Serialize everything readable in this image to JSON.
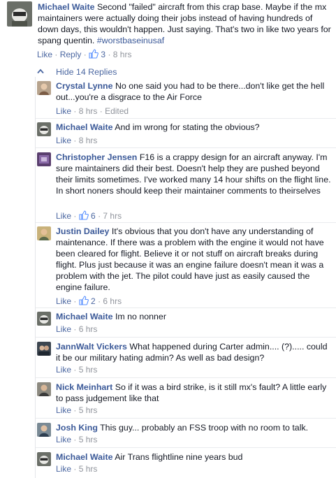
{
  "top_comment": {
    "author": "Michael Waite",
    "text": "Second \"failed\" aircraft from this crap base. Maybe if the mx maintainers were actually doing their jobs instead of having hundreds of down days, this wouldn't happen. Just saying. That's two in like two years for spang quentin.",
    "hashtag": "#worstbaseinusaf",
    "like_label": "Like",
    "reply_label": "Reply",
    "likes": "3",
    "time": "8 hrs"
  },
  "hide_replies_label": "Hide 14 Replies",
  "replies": [
    {
      "author": "Crystal Lynne",
      "text": "No one said you had to be there...don't like get the hell out...you're a disgrace to the Air Force",
      "like_label": "Like",
      "time": "8 hrs",
      "edited": "Edited",
      "likes": ""
    },
    {
      "author": "Michael Waite",
      "text": "And im wrong for stating the obvious?",
      "like_label": "Like",
      "time": "8 hrs",
      "edited": "",
      "likes": ""
    },
    {
      "author": "Christopher Jensen",
      "text": "F16 is a crappy design for an aircraft anyway. I'm sure maintainers did their best. Doesn't help they are pushed beyond their limits sometimes. I've worked many 14 hour shifts on the flight line. In short noners should keep their maintainer comments to theirselves",
      "like_label": "Like",
      "time": "7 hrs",
      "edited": "",
      "likes": "6"
    },
    {
      "author": "Justin Dailey",
      "text": "It's obvious that you don't have any understanding of maintenance. If there was a problem with the engine it would not have been cleared for flight. Believe it or not stuff on aircraft breaks during flight. Plus just because it was an engine failure doesn't mean it was a problem with the jet. The pilot could have just as easily caused the engine failure.",
      "like_label": "Like",
      "time": "6 hrs",
      "edited": "",
      "likes": "2"
    },
    {
      "author": "Michael Waite",
      "text": "Im no nonner",
      "like_label": "Like",
      "time": "6 hrs",
      "edited": "",
      "likes": ""
    },
    {
      "author": "JannWalt Vickers",
      "text": "What happened during Carter admin.... (?)..... could it be our military hating admin? As well as bad design?",
      "like_label": "Like",
      "time": "5 hrs",
      "edited": "",
      "likes": ""
    },
    {
      "author": "Nick Meinhart",
      "text": "So if it was a bird strike, is it still mx's fault? A little early to pass judgement like that",
      "like_label": "Like",
      "time": "5 hrs",
      "edited": "",
      "likes": ""
    },
    {
      "author": "Josh King",
      "text": "This guy... probably an FSS troop with no room to talk.",
      "like_label": "Like",
      "time": "5 hrs",
      "edited": "",
      "likes": ""
    },
    {
      "author": "Michael Waite",
      "text": "Air Trans flightline nine years bud",
      "like_label": "Like",
      "time": "5 hrs",
      "edited": "",
      "likes": ""
    }
  ],
  "colors": {
    "link": "#3b5998",
    "meta": "#90949c",
    "like_badge": "#5890ff",
    "divider": "#e9ebee"
  }
}
